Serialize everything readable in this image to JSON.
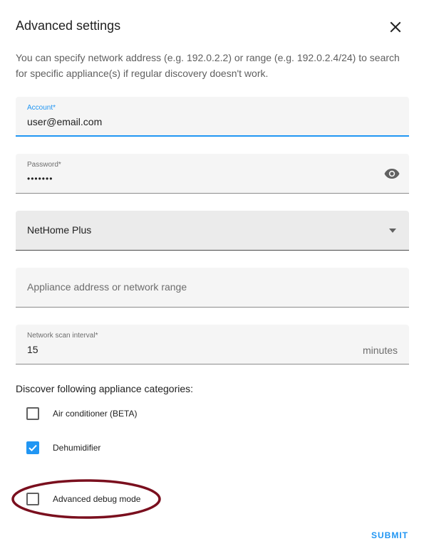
{
  "dialog": {
    "title": "Advanced settings",
    "description": "You can specify network address (e.g. 192.0.2.2) or range (e.g. 192.0.2.4/24) to search for specific appliance(s) if regular discovery doesn't work."
  },
  "fields": {
    "account": {
      "label": "Account*",
      "value": "user@email.com"
    },
    "password": {
      "label": "Password*",
      "value": "•••••••"
    },
    "app": {
      "value": "NetHome Plus"
    },
    "address": {
      "placeholder": "Appliance address or network range"
    },
    "scan_interval": {
      "label": "Network scan interval*",
      "value": "15",
      "suffix": "minutes"
    }
  },
  "categories": {
    "label": "Discover following appliance categories:",
    "items": [
      {
        "label": "Air conditioner (BETA)",
        "checked": false
      },
      {
        "label": "Dehumidifier",
        "checked": true
      }
    ]
  },
  "debug": {
    "label": "Advanced debug mode",
    "checked": false
  },
  "actions": {
    "submit_label": "SUBMIT"
  },
  "colors": {
    "accent": "#2196f3",
    "annotation": "#7a0f1e"
  },
  "icons": {
    "close": "close-icon",
    "eye": "eye-icon",
    "dropdown": "dropdown-arrow-icon",
    "check": "checkmark-icon"
  }
}
